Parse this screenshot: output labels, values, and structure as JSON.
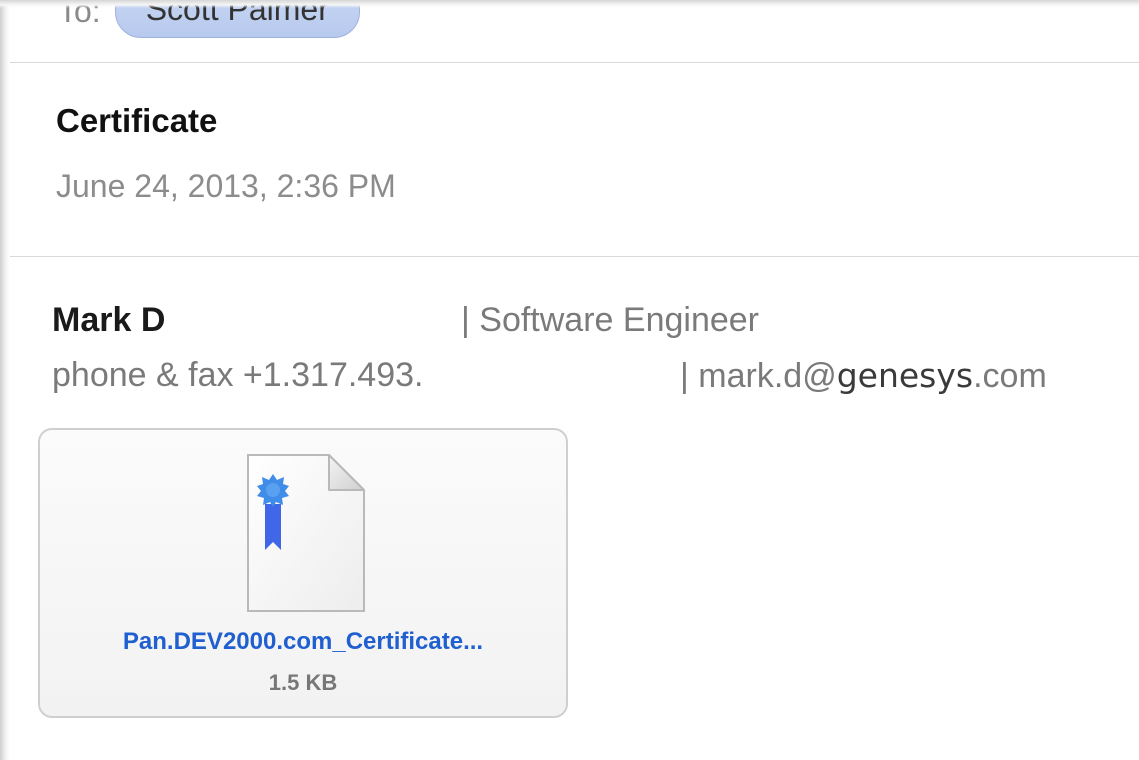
{
  "header": {
    "to_label": "To:",
    "recipient": "Scott Palmer"
  },
  "message": {
    "subject": "Certificate",
    "date": "June 24, 2013, 2:36 PM"
  },
  "signature": {
    "name": "Mark D",
    "title": "| Software Engineer",
    "phone": "phone & fax +1.317.493.",
    "email_prefix": "| mark.d@",
    "email_domain": "genesys",
    "email_suffix": ".com"
  },
  "attachment": {
    "filename": "Pan.DEV2000.com_Certificate...",
    "size": "1.5 KB",
    "icon": "certificate-document-icon"
  },
  "colors": {
    "link_blue": "#1f5fcf",
    "chip_blue": "#c9d8f3",
    "ribbon_blue": "#3f67e8"
  }
}
